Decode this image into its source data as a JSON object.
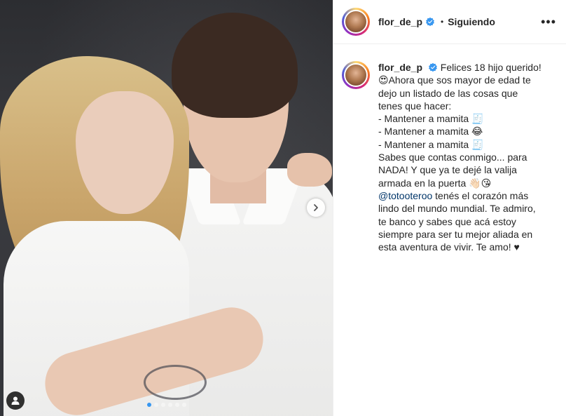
{
  "post": {
    "photo_alt": "",
    "carousel": {
      "total": 6,
      "active": 0
    }
  },
  "header": {
    "username": "flor_de_p",
    "verified": true,
    "separator": "•",
    "follow_state": "Siguiendo",
    "more_label": "•••"
  },
  "caption": {
    "username": "flor_de_p",
    "lines": [
      "Felices 18 hijo querido!",
      "😍Ahora que sos mayor de edad te",
      "dejo un listado de las cosas que",
      "tenes que hacer:",
      "- Mantener a mamita 🧾",
      "- Mantener a mamita 😂",
      "- Mantener a mamita 🧾",
      "Sabes que contas conmigo... para",
      "NADA! Y que ya te dejé la valija",
      "armada en la puerta 👋🏻😘"
    ],
    "mention": "@totooteroo",
    "mention_rest": " tenés el corazón más",
    "lines_after": [
      "lindo del mundo mundial. Te admiro,",
      "te banco y sabes que acá estoy",
      "siempre para ser tu mejor aliada en",
      "esta aventura de vivir. Te amo! ♥"
    ]
  },
  "colors": {
    "verified_blue": "#3897f0",
    "link": "#003569",
    "text": "#262626"
  },
  "icons": {
    "next": "chevron-right-icon",
    "tag": "user-tag-icon",
    "verified": "verified-badge-icon",
    "more": "more-options-icon"
  }
}
